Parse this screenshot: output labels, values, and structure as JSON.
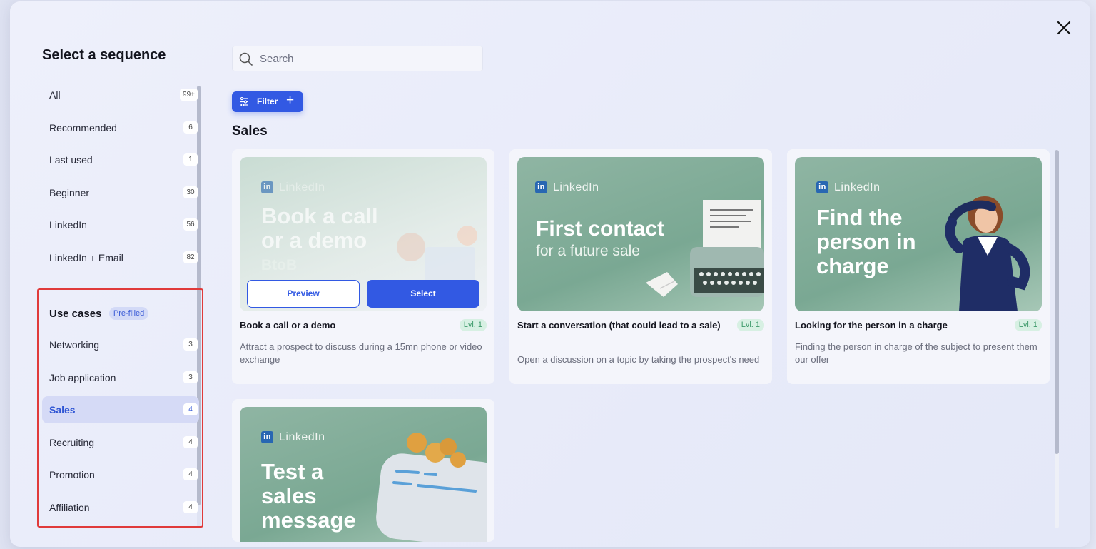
{
  "modal": {
    "title": "Select a sequence",
    "close_icon": "close-icon"
  },
  "sidebar": {
    "items": [
      {
        "label": "All",
        "count": "99+"
      },
      {
        "label": "Recommended",
        "count": "6"
      },
      {
        "label": "Last used",
        "count": "1"
      },
      {
        "label": "Beginner",
        "count": "30"
      },
      {
        "label": "LinkedIn",
        "count": "56"
      },
      {
        "label": "LinkedIn + Email",
        "count": "82"
      }
    ],
    "use_cases": {
      "title": "Use cases",
      "badge": "Pre-filled",
      "items": [
        {
          "label": "Networking",
          "count": "3"
        },
        {
          "label": "Job application",
          "count": "3"
        },
        {
          "label": "Sales",
          "count": "4",
          "active": true
        },
        {
          "label": "Recruiting",
          "count": "4"
        },
        {
          "label": "Promotion",
          "count": "4"
        },
        {
          "label": "Affiliation",
          "count": "4"
        }
      ]
    }
  },
  "search": {
    "placeholder": "Search",
    "value": ""
  },
  "filter": {
    "label": "Filter"
  },
  "section": {
    "title": "Sales"
  },
  "cards": [
    {
      "thumb_brand": "LinkedIn",
      "thumb_headline": "Book a call or a demo",
      "thumb_sub": "BtoB",
      "title": "Book a call or a demo",
      "level": "Lvl. 1",
      "description": "Attract a prospect to discuss during a 15mn phone or video exchange",
      "preview_label": "Preview",
      "select_label": "Select"
    },
    {
      "thumb_brand": "LinkedIn",
      "thumb_headline": "First contact",
      "thumb_sub": "for a future sale",
      "title": "Start a conversation (that could lead to a sale)",
      "level": "Lvl. 1",
      "description": "Open a discussion on a topic by taking the prospect's need"
    },
    {
      "thumb_brand": "LinkedIn",
      "thumb_headline": "Find the person in charge",
      "title": "Looking for the person in a charge",
      "level": "Lvl. 1",
      "description": "Finding the person in charge of the subject to present them our offer"
    },
    {
      "thumb_brand": "LinkedIn",
      "thumb_headline": "Test a sales message"
    }
  ],
  "colors": {
    "accent": "#3259e3",
    "highlight": "#e03a3a",
    "level_bg": "#d7f0e3"
  }
}
